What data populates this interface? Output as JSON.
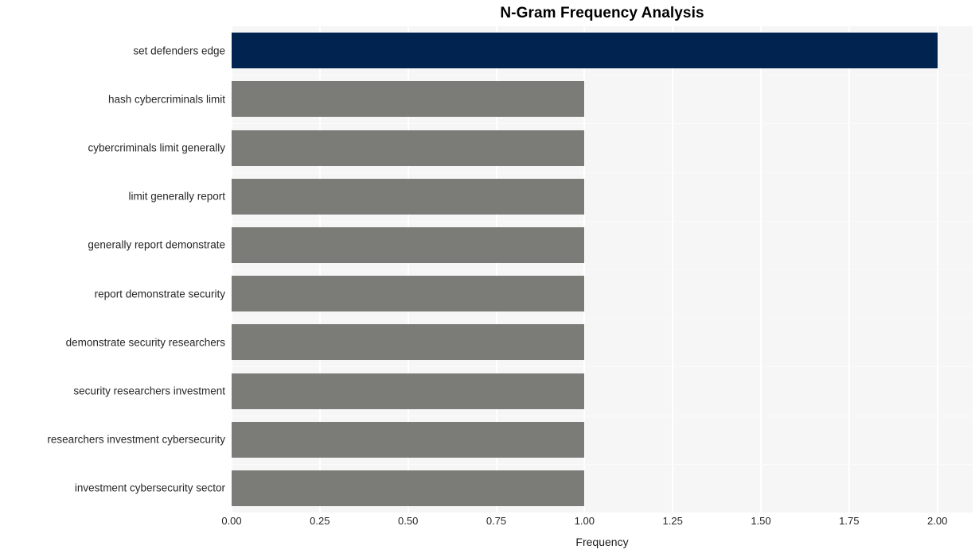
{
  "chart_data": {
    "type": "bar",
    "orientation": "horizontal",
    "title": "N-Gram Frequency Analysis",
    "xlabel": "Frequency",
    "ylabel": "",
    "xlim": [
      0.0,
      2.1
    ],
    "xticks": [
      "0.00",
      "0.25",
      "0.50",
      "0.75",
      "1.00",
      "1.25",
      "1.50",
      "1.75",
      "2.00"
    ],
    "xtick_values": [
      0.0,
      0.25,
      0.5,
      0.75,
      1.0,
      1.25,
      1.5,
      1.75,
      2.0
    ],
    "grid": true,
    "legend": "none",
    "categories": [
      "set defenders edge",
      "hash cybercriminals limit",
      "cybercriminals limit generally",
      "limit generally report",
      "generally report demonstrate",
      "report demonstrate security",
      "demonstrate security researchers",
      "security researchers investment",
      "researchers investment cybersecurity",
      "investment cybersecurity sector"
    ],
    "values": [
      2,
      1,
      1,
      1,
      1,
      1,
      1,
      1,
      1,
      1
    ],
    "bar_colors": [
      "#00244f",
      "#7b7b78",
      "#7b7b78",
      "#7b7b78",
      "#7b7b78",
      "#7b7b78",
      "#7b7b78",
      "#7b7b78",
      "#7b7b78",
      "#7b7b78"
    ],
    "plot_background": "#f6f6f7",
    "gridline_color": "#ffffff",
    "figure_background": "#ffffff",
    "highlight_color": "#00244f",
    "default_bar_color": "#7b7b78"
  }
}
